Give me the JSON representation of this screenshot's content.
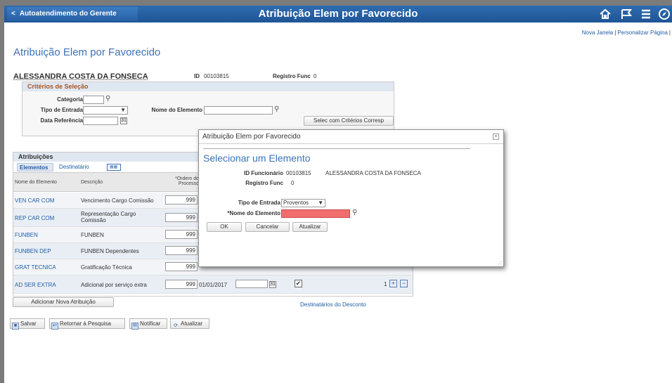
{
  "topbar": {
    "back_label": "Autoatendimento do Gerente",
    "title": "Atribuição Elem por Favorecido",
    "home_icon": "home-icon",
    "flag_icon": "flag-icon",
    "menu_icon": "menu-icon",
    "nav_icon": "compass-icon"
  },
  "links": {
    "new_window": "Nova Janela",
    "personalize": "Personalizar Página"
  },
  "page": {
    "title": "Atribuição Elem por Favorecido"
  },
  "employee": {
    "name": "ALESSANDRA COSTA DA FONSECA",
    "id_label": "ID",
    "id_value": "00103815",
    "reg_label": "Registro Func",
    "reg_value": "0"
  },
  "criteria": {
    "section_title": "Critérios de Seleção",
    "category_label": "Categoria",
    "category_value": "",
    "entry_type_label": "Tipo de Entrada",
    "entry_type_value": "",
    "element_name_label": "Nome do Elemento",
    "element_name_value": "",
    "ref_date_label": "Data Referência",
    "ref_date_value": "",
    "search_button": "Selec com Critérios Corresp"
  },
  "attributions": {
    "section_title": "Atribuições",
    "tabs": [
      "Elementos",
      "Destinatário"
    ],
    "columns": {
      "element": "Nome do Elemento",
      "description": "Descrição",
      "order": "*Ordem do Processo"
    },
    "rows": [
      {
        "element": "VEN CAR COM",
        "description": "Vencimento Cargo Comissão",
        "order": "999"
      },
      {
        "element": "REP CAR COM",
        "description": "Representação Cargo Comissão",
        "order": "999"
      },
      {
        "element": "FUNBEN",
        "description": "FUNBEN",
        "order": "999"
      },
      {
        "element": "FUNBEN DEP",
        "description": "FUNBEN Dependentes",
        "order": "999"
      },
      {
        "element": "GRAT TECNICA",
        "description": "Gratificação Técnica",
        "order": "999"
      },
      {
        "element": "AD SER EXTRA",
        "description": "Adicional por serviço extra",
        "order": "999",
        "date": "01/01/2017",
        "count": "1"
      }
    ],
    "add_button": "Adicionar Nova Atribuição",
    "dest_link": "Destinatários do Desconto"
  },
  "toolbar": {
    "save": "Salvar",
    "return": "Retornar à Pesquisa",
    "notify": "Notificar",
    "refresh": "Atualizar"
  },
  "modal": {
    "title": "Atribuição Elem por Favorecido",
    "heading": "Selecionar um Elemento",
    "emp_id_label": "ID Funcionário",
    "emp_id_value": "00103815",
    "emp_name": "ALESSANDRA COSTA DA FONSECA",
    "reg_label": "Registro Func",
    "reg_value": "0",
    "entry_type_label": "Tipo de Entrada",
    "entry_type_value": "Proventos",
    "element_label": "*Nome do Elemento",
    "element_value": "",
    "ok": "OK",
    "cancel": "Cancelar",
    "refresh": "Atualizar"
  }
}
